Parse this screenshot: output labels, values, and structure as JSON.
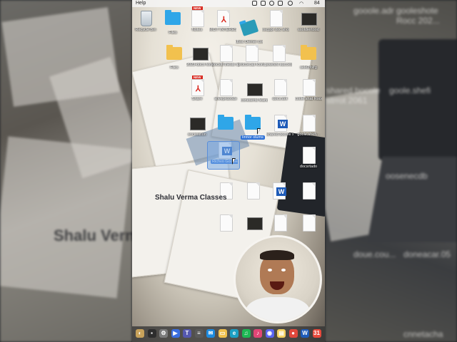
{
  "menubar": {
    "app_label": "Help",
    "battery": "84"
  },
  "desktop": {
    "icons": [
      {
        "name": "recycle-bin",
        "label": "Recycle Bin",
        "kind": "bin"
      },
      {
        "name": "files-folder",
        "label": "Files",
        "kind": "folder-blue"
      },
      {
        "name": "notes",
        "label": "Notes",
        "kind": "doc",
        "badge": "NEW"
      },
      {
        "name": "pdf-1",
        "label": "MCIT INTEREST cument con",
        "kind": "pdf"
      },
      {
        "name": "dbs-demer-folder",
        "label": "dbsc Demer cower gone",
        "kind": "folder-teal"
      },
      {
        "name": "doc-oscppr",
        "label": "oscppr doc sholu docment",
        "kind": "doc"
      },
      {
        "name": "thinkpad-doc",
        "label": "ssoldiertood",
        "kind": "photo"
      },
      {
        "name": "files-yellow",
        "label": "Files",
        "kind": "folder-yellow"
      },
      {
        "name": "photo-nature",
        "label": "2023-doco fonsent fre",
        "kind": "photo"
      },
      {
        "name": "doc-2",
        "label": "docsfit thesis tomforg Ds",
        "kind": "doc"
      },
      {
        "name": "doc-3",
        "label": "prdcorcas fcordit pdf",
        "kind": "doc"
      },
      {
        "name": "doc-4",
        "label": "powrsnt succesctia",
        "kind": "doc"
      },
      {
        "name": "files-yellow-2",
        "label": "sele2folfg",
        "kind": "folder-yellow"
      },
      {
        "name": "pdf-2",
        "label": "Share",
        "kind": "pdf",
        "badge": "NEW"
      },
      {
        "name": "doc-5",
        "label": "sfiveprdoodx",
        "kind": "doc"
      },
      {
        "name": "photo-2",
        "label": "coneserts feance",
        "kind": "photo"
      },
      {
        "name": "doc-6",
        "label": "docs.dot",
        "kind": "doc"
      },
      {
        "name": "doc-7",
        "label": "coole shat Roce 202",
        "kind": "doc"
      },
      {
        "name": "photo-3",
        "label": "sociosiflon",
        "kind": "photo"
      },
      {
        "name": "folder-blue-2",
        "label": "",
        "kind": "folder-blue"
      },
      {
        "name": "folder-linnor",
        "label": "linnor olums",
        "kind": "folder-blue",
        "selected": true
      },
      {
        "name": "word-1",
        "label": "shared bocole strrot 2061",
        "kind": "word"
      },
      {
        "name": "doc-goole",
        "label": "goole.shefi...",
        "kind": "doc"
      },
      {
        "name": "word-richvo",
        "label": "Richvo Goolse",
        "kind": "word",
        "selected": true
      },
      {
        "name": "doc-doteo",
        "label": "docsrtado",
        "kind": "doc"
      },
      {
        "name": "doc-8",
        "label": "",
        "kind": "doc"
      },
      {
        "name": "pdf-3",
        "label": "",
        "kind": "pdf",
        "badge": "NEW"
      },
      {
        "name": "doc-9",
        "label": "",
        "kind": "doc"
      },
      {
        "name": "word-2",
        "label": "",
        "kind": "word"
      },
      {
        "name": "doc-10",
        "label": "",
        "kind": "doc"
      },
      {
        "name": "doc-11",
        "label": "",
        "kind": "doc"
      },
      {
        "name": "photo-4",
        "label": "",
        "kind": "photo"
      },
      {
        "name": "doc-12",
        "label": "",
        "kind": "doc"
      },
      {
        "name": "doc-13",
        "label": "",
        "kind": "doc"
      }
    ],
    "watermark": "Shalu Verma Classes"
  },
  "side_overlay": {
    "left_title": "Shalu Verm",
    "right_labels": [
      "gooole.adr",
      "gooleshote Rocc 202...",
      "goole.shefi",
      "shared bocole strrot 2061",
      "oosenecdb",
      "doue.cou...",
      "doneacar.05",
      "cnnetacha"
    ]
  },
  "dock": {
    "items": [
      {
        "name": "finder",
        "glyph": "◐",
        "color": "#c8a25a"
      },
      {
        "name": "app-dark",
        "glyph": "▪",
        "color": "#2d2d2d"
      },
      {
        "name": "settings",
        "glyph": "⚙",
        "color": "#7b7b7b"
      },
      {
        "name": "zoom",
        "glyph": "▶",
        "color": "#3a6ee0"
      },
      {
        "name": "teams",
        "glyph": "T",
        "color": "#5558af"
      },
      {
        "name": "files-app",
        "glyph": "≡",
        "color": "#5a5a5a"
      },
      {
        "name": "mail",
        "glyph": "✉",
        "color": "#1d8be0"
      },
      {
        "name": "folder",
        "glyph": "▭",
        "color": "#f2c14e"
      },
      {
        "name": "edge",
        "glyph": "e",
        "color": "#1ca0c4"
      },
      {
        "name": "spotify",
        "glyph": "♫",
        "color": "#1db954"
      },
      {
        "name": "itunes",
        "glyph": "♪",
        "color": "#e04676"
      },
      {
        "name": "discord",
        "glyph": "◉",
        "color": "#5865f2"
      },
      {
        "name": "notes-app",
        "glyph": "▤",
        "color": "#f4d160"
      },
      {
        "name": "chrome",
        "glyph": "●",
        "color": "#e0483c"
      },
      {
        "name": "word-app",
        "glyph": "W",
        "color": "#1e5bb8"
      },
      {
        "name": "calendar",
        "glyph": "31",
        "color": "#e84a3c"
      }
    ]
  }
}
